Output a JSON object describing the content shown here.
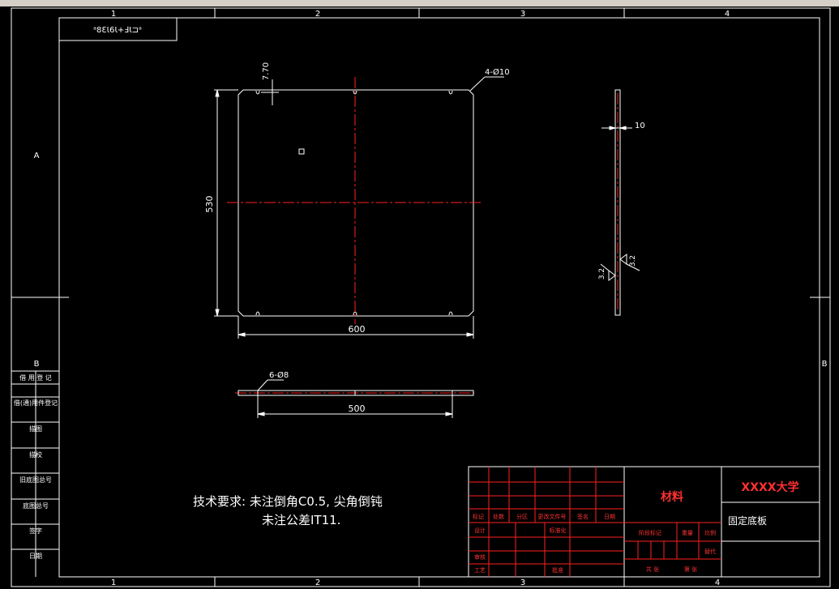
{
  "frame": {
    "columns": [
      "1",
      "2",
      "3",
      "4"
    ],
    "rows": [
      "A",
      "B"
    ],
    "mirrored_stamp": "ᵃ8ƐƖ6Ɩ+ℲƖ⊐ᵃ"
  },
  "dimensions": {
    "chamfer": "7.70",
    "holes": "4-Ø10",
    "height": "530",
    "width": "600",
    "thickness": "10",
    "slots": "6-Ø8",
    "slot_span": "500",
    "roughness_1": "3.2",
    "roughness_2": "3.2"
  },
  "tech_requirements": {
    "line1": "技术要求: 未注倒角C0.5, 尖角倒钝",
    "line2": "未注公差IT11."
  },
  "title_block": {
    "material": "材料",
    "university": "XXXX大学",
    "part_name": "固定底板",
    "headers": [
      "标记",
      "处数",
      "分区",
      "更改文件号",
      "签名",
      "日期"
    ],
    "design": "设计",
    "standardization": "标准化",
    "review": "审核",
    "process": "工艺",
    "approve": "批准",
    "stage_mark": "阶段标记",
    "weight": "重量",
    "scale": "比例",
    "sheets": "共  张",
    "sheet_no": "第  张",
    "version": "替代"
  },
  "side_panel": [
    "借  用  登  记",
    "借(通)用件登记",
    "描图",
    "描校",
    "旧底图总号",
    "底图总号",
    "签字",
    "日期"
  ],
  "colors": {
    "background": "#000000",
    "line": "#ffffff",
    "center_line": "#ff2020",
    "title_red": "#ff3030"
  }
}
